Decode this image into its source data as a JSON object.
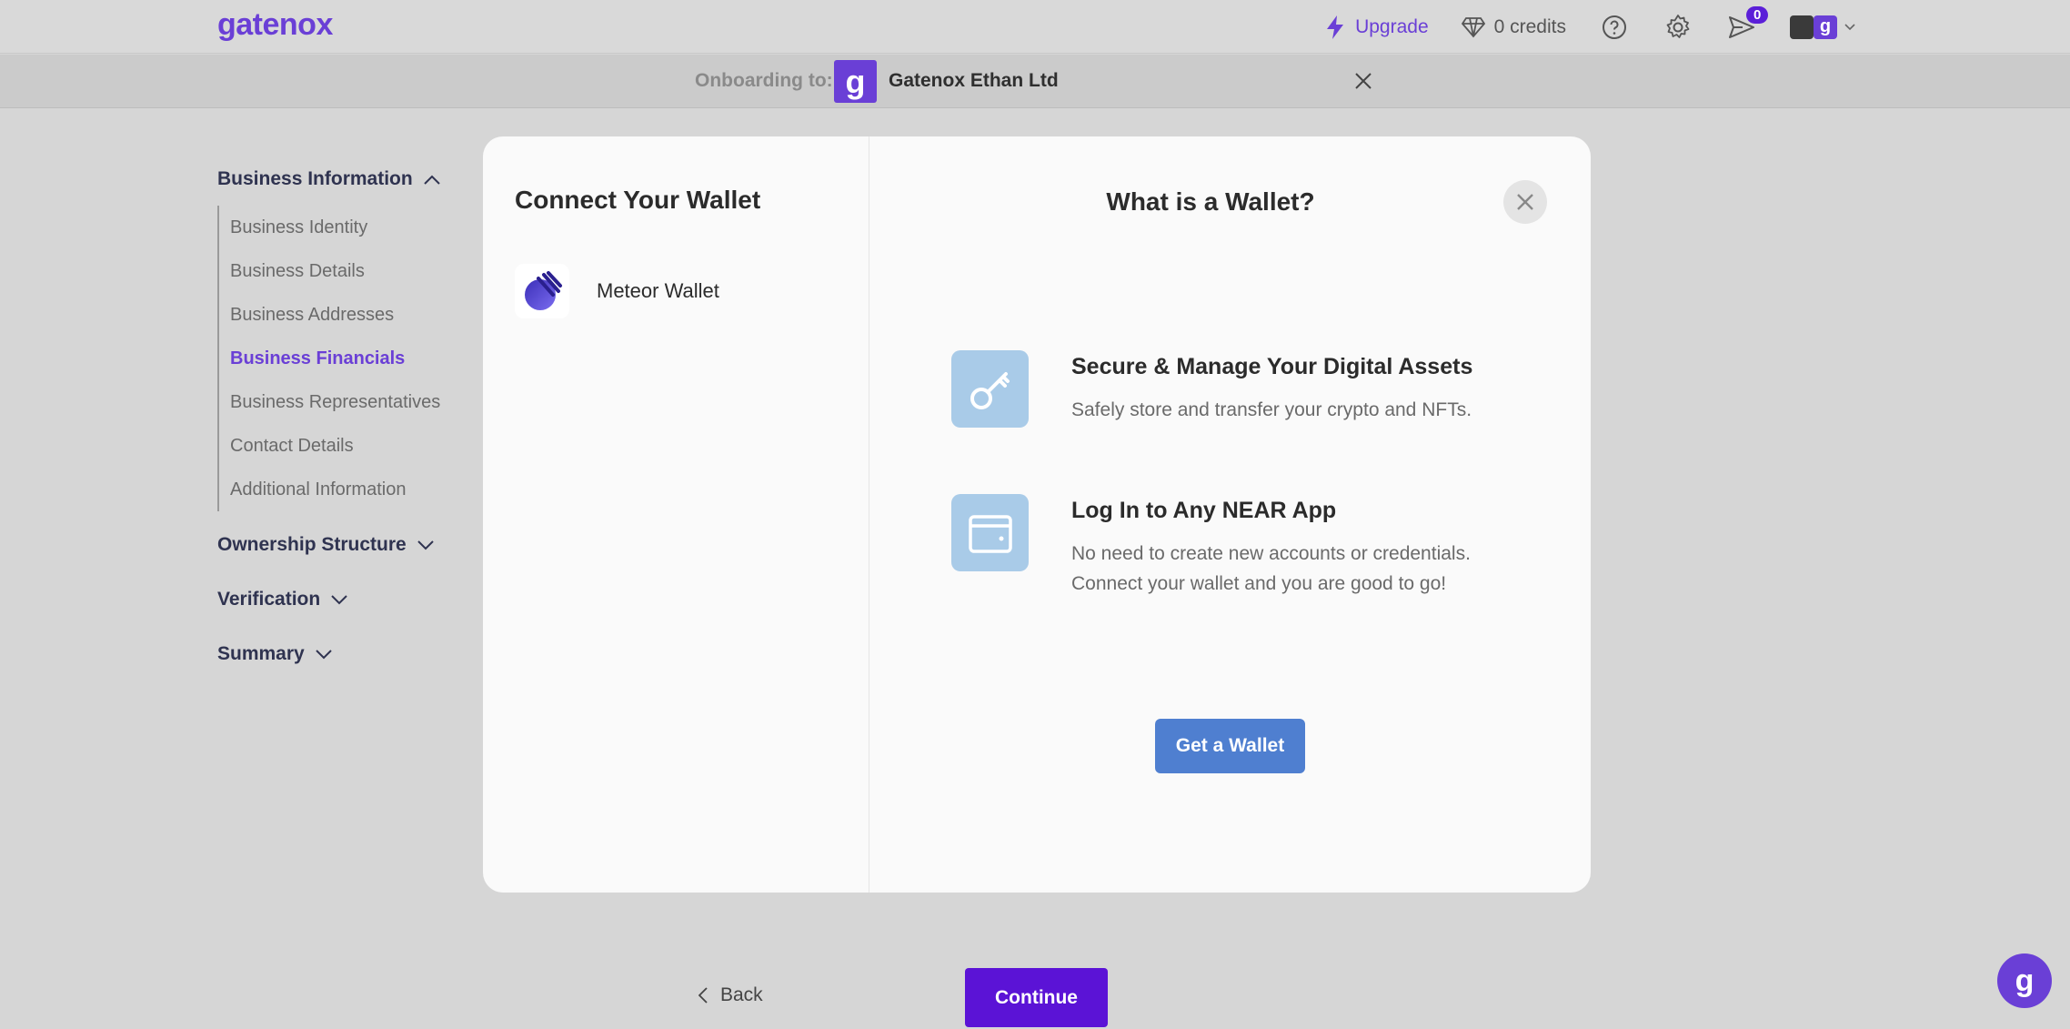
{
  "header": {
    "logo": "gatenox",
    "upgrade_label": "Upgrade",
    "credits_label": "0 credits",
    "notifications_count": "0",
    "avatar_letter": "g"
  },
  "onboarding": {
    "label": "Onboarding to:",
    "company_logo_letter": "g",
    "company_name": "Gatenox Ethan Ltd"
  },
  "sidebar": {
    "sections": [
      {
        "title": "Business Information",
        "items": [
          "Business Identity",
          "Business Details",
          "Business Addresses",
          "Business Financials",
          "Business Representatives",
          "Contact Details",
          "Additional Information"
        ],
        "active_item": "Business Financials"
      },
      {
        "title": "Ownership Structure"
      },
      {
        "title": "Verification"
      },
      {
        "title": "Summary"
      }
    ]
  },
  "modal": {
    "left_title": "Connect Your Wallet",
    "wallets": [
      {
        "name": "Meteor Wallet"
      }
    ],
    "right_title": "What is a Wallet?",
    "features": [
      {
        "title": "Secure & Manage Your Digital Assets",
        "description": "Safely store and transfer your crypto and NFTs.",
        "icon": "key-icon"
      },
      {
        "title": "Log In to Any NEAR App",
        "description": "No need to create new accounts or credentials. Connect your wallet and you are good to go!",
        "icon": "wallet-icon"
      }
    ],
    "cta_label": "Get a Wallet"
  },
  "footer": {
    "back_label": "Back",
    "continue_label": "Continue"
  },
  "colors": {
    "brand": "#6a3fd6",
    "primary_button": "#5b13d6",
    "cta_button": "#4f7fd0",
    "feature_icon_bg": "#a9cbe8"
  }
}
